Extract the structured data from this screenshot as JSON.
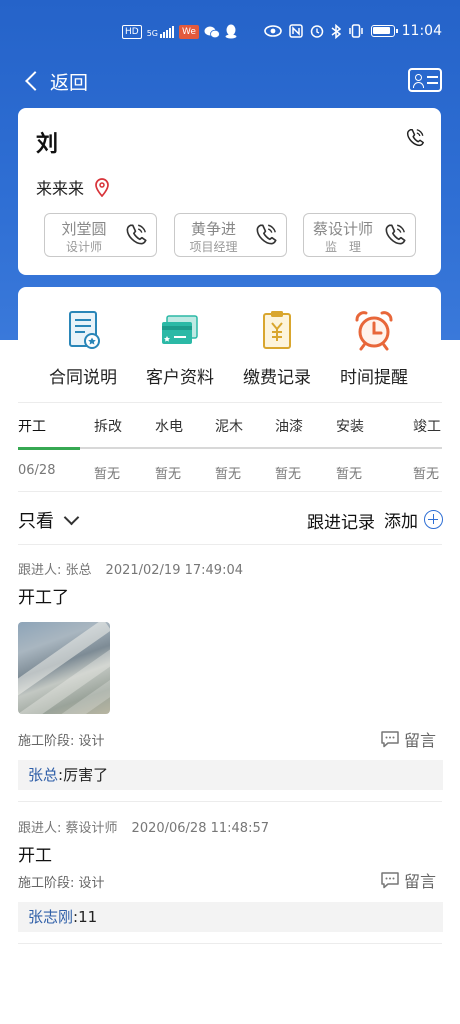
{
  "status_bar": {
    "icons": [
      "hd-icon",
      "signal-icon",
      "weibo-icon",
      "wechat-icon",
      "qq-icon",
      "eye-icon",
      "nfc-icon",
      "alarm-icon",
      "bluetooth-icon",
      "vibrate-icon",
      "battery-icon"
    ],
    "hd": "HD",
    "net": "5G",
    "we": "We",
    "time": "11:04"
  },
  "nav": {
    "back_label": "返回"
  },
  "customer": {
    "name": "刘",
    "address": "来来来"
  },
  "staff": [
    {
      "name": "刘堂圆",
      "role": "设计师"
    },
    {
      "name": "黄争进",
      "role": "项目经理"
    },
    {
      "name": "蔡设计师",
      "role": "监　理"
    }
  ],
  "features": [
    {
      "label": "合同说明",
      "icon": "contract-icon"
    },
    {
      "label": "客户资料",
      "icon": "customer-card-icon"
    },
    {
      "label": "缴费记录",
      "icon": "payment-icon"
    },
    {
      "label": "时间提醒",
      "icon": "alarm-clock-icon"
    }
  ],
  "stages": [
    {
      "name": "开工",
      "value": "06/28"
    },
    {
      "name": "拆改",
      "value": "暂无"
    },
    {
      "name": "水电",
      "value": "暂无"
    },
    {
      "name": "泥木",
      "value": "暂无"
    },
    {
      "name": "油漆",
      "value": "暂无"
    },
    {
      "name": "安装",
      "value": "暂无"
    },
    {
      "name": "竣工",
      "value": "暂无"
    }
  ],
  "filter_label": "只看",
  "records_title": "跟进记录",
  "add_label": "添加",
  "records": [
    {
      "follower_label": "跟进人:",
      "follower": "张总",
      "time": "2021/02/19 17:49:04",
      "content": "开工了",
      "stage_info": "施工阶段: 设计",
      "message_label": "留言",
      "comment_user": "张总",
      "comment_text": ":厉害了"
    },
    {
      "follower_label": "跟进人:",
      "follower": "蔡设计师",
      "time": "2020/06/28 11:48:57",
      "content": "开工",
      "stage_info": "施工阶段: 设计",
      "message_label": "留言",
      "comment_user": "张志刚",
      "comment_text": ":11"
    }
  ],
  "colors": {
    "header_blue": "#2f6fd4",
    "active_green": "#36a852",
    "comment_blue": "#2f5fa8"
  }
}
